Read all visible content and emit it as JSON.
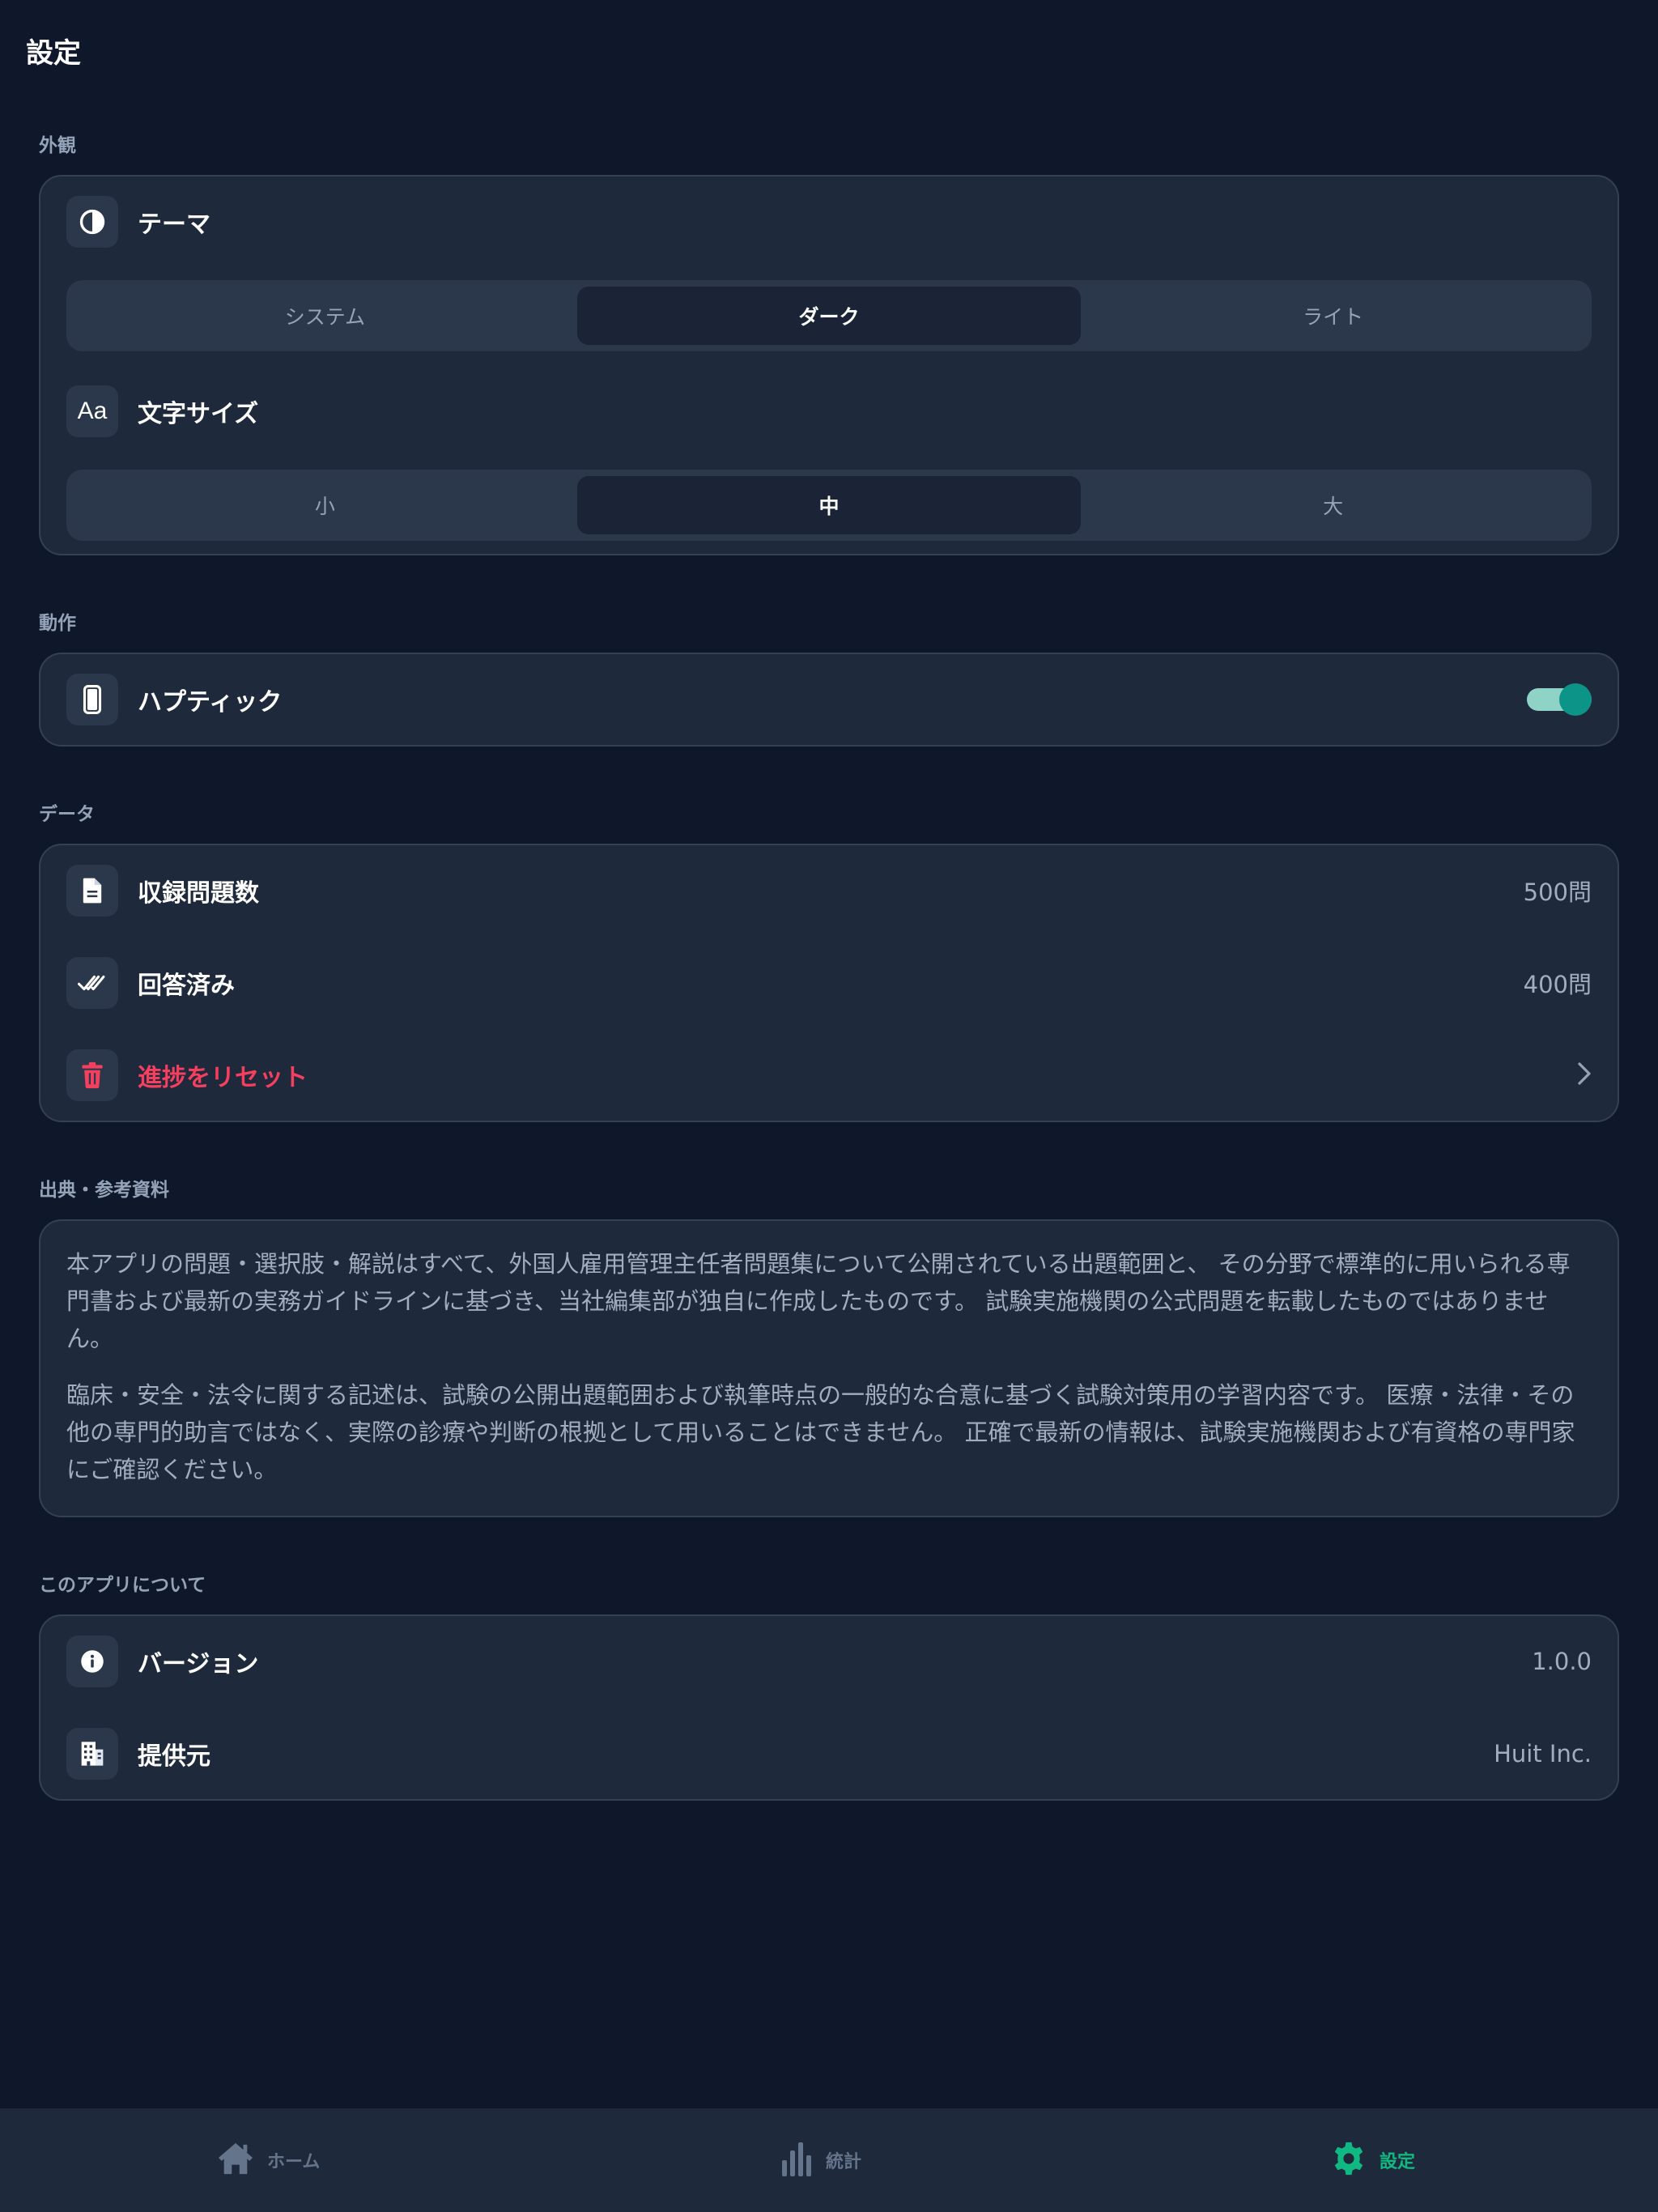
{
  "header": {
    "title": "設定"
  },
  "appearance": {
    "section_label": "外観",
    "theme": {
      "label": "テーマ",
      "icon": "contrast-icon",
      "options": [
        "システム",
        "ダーク",
        "ライト"
      ],
      "selected": "ダーク"
    },
    "font_size": {
      "label": "文字サイズ",
      "icon": "text-size-icon",
      "icon_text": "Aa",
      "options": [
        "小",
        "中",
        "大"
      ],
      "selected": "中"
    }
  },
  "behavior": {
    "section_label": "動作",
    "haptic": {
      "label": "ハプティック",
      "icon": "phone-icon",
      "enabled": true
    }
  },
  "data_section": {
    "section_label": "データ",
    "total_questions": {
      "label": "収録問題数",
      "value": "500問",
      "icon": "document-icon"
    },
    "answered": {
      "label": "回答済み",
      "value": "400問",
      "icon": "double-check-icon"
    },
    "reset": {
      "label": "進捗をリセット",
      "icon": "trash-icon"
    }
  },
  "sources": {
    "section_label": "出典・参考資料",
    "paragraphs": [
      "本アプリの問題・選択肢・解説はすべて、外国人雇用管理主任者問題集について公開されている出題範囲と、 その分野で標準的に用いられる専門書および最新の実務ガイドラインに基づき、当社編集部が独自に作成したものです。 試験実施機関の公式問題を転載したものではありません。",
      "臨床・安全・法令に関する記述は、試験の公開出題範囲および執筆時点の一般的な合意に基づく試験対策用の学習内容です。 医療・法律・その他の専門的助言ではなく、実際の診療や判断の根拠として用いることはできません。 正確で最新の情報は、試験実施機関および有資格の専門家にご確認ください。"
    ]
  },
  "about": {
    "section_label": "このアプリについて",
    "version": {
      "label": "バージョン",
      "value": "1.0.0",
      "icon": "info-icon"
    },
    "provider": {
      "label": "提供元",
      "value": "Huit Inc.",
      "icon": "building-icon"
    }
  },
  "tabbar": {
    "tabs": [
      {
        "label": "ホーム",
        "icon": "home-icon"
      },
      {
        "label": "統計",
        "icon": "bar-chart-icon"
      },
      {
        "label": "設定",
        "icon": "gear-icon"
      }
    ],
    "active": "設定"
  },
  "colors": {
    "background": "#0f172a",
    "card": "#1e293b",
    "accent": "#10b981",
    "toggle_on": "#0d9488",
    "danger": "#f43f5e"
  }
}
